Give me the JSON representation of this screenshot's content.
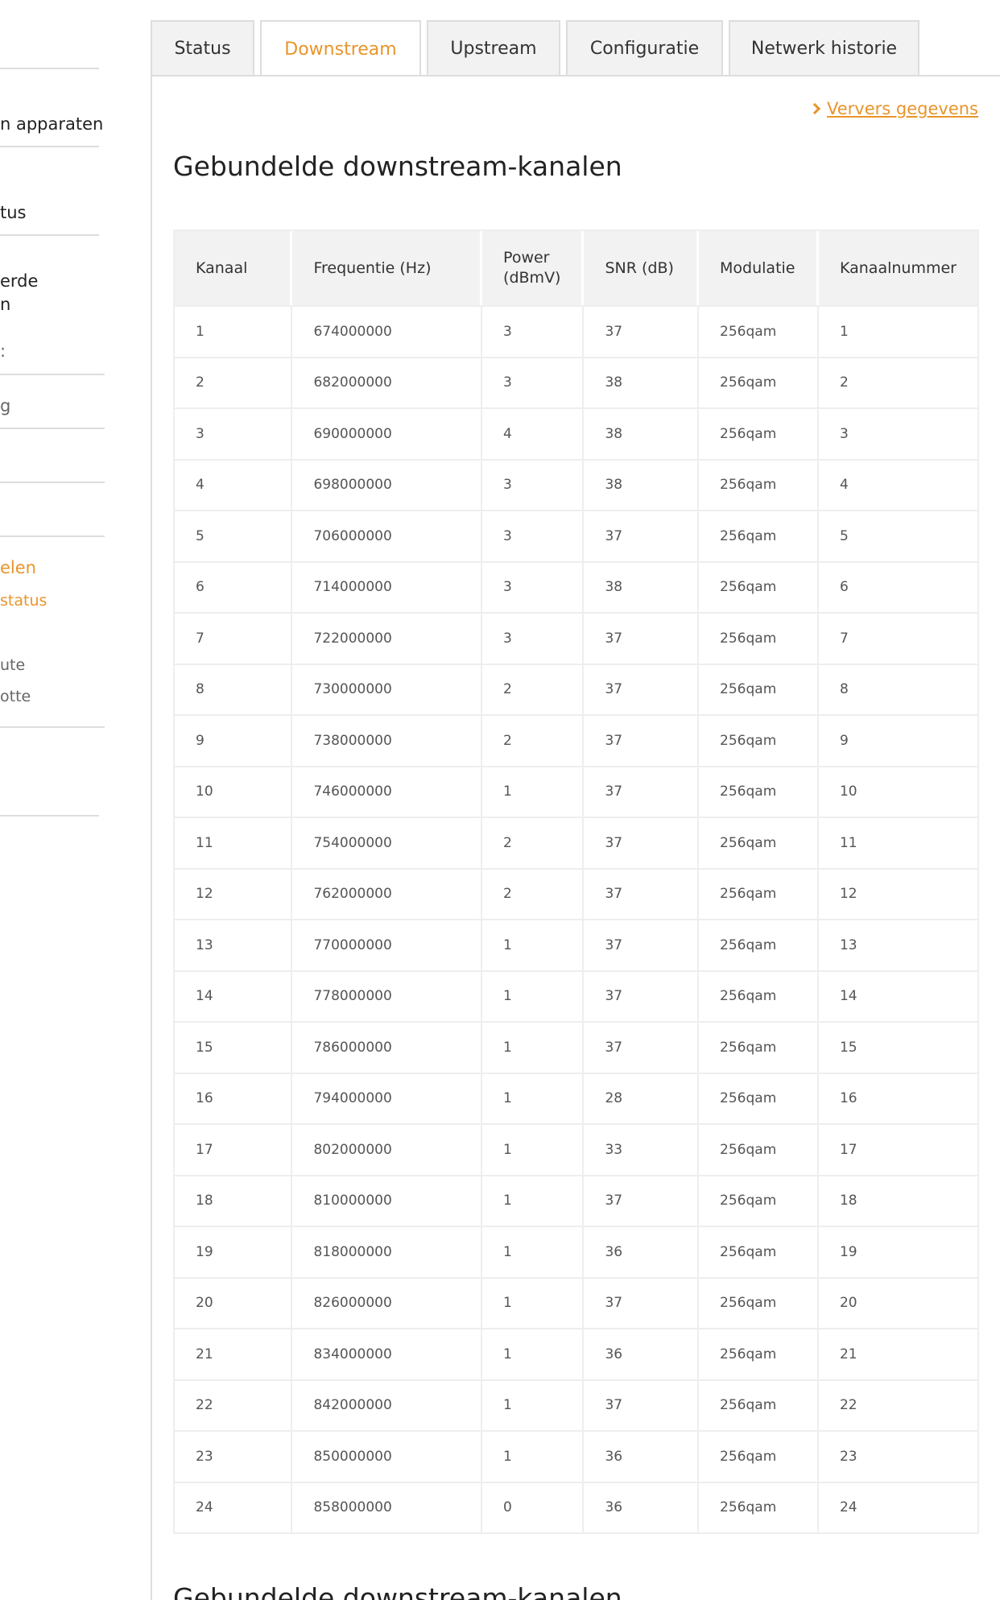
{
  "sidebar": {
    "items": [
      {
        "label": "n apparaten"
      },
      {
        "label": "tus"
      },
      {
        "label": "erde"
      },
      {
        "label": "n"
      },
      {
        "label": ":"
      },
      {
        "label": "g"
      },
      {
        "label": "elen"
      },
      {
        "label": "status"
      },
      {
        "label": "ute"
      },
      {
        "label": "otte"
      }
    ]
  },
  "tabs": [
    {
      "label": "Status"
    },
    {
      "label": "Downstream"
    },
    {
      "label": "Upstream"
    },
    {
      "label": "Configuratie"
    },
    {
      "label": "Netwerk historie"
    }
  ],
  "active_tab": "Downstream",
  "refresh": {
    "label": "Ververs gegevens"
  },
  "section": {
    "title": "Gebundelde downstream-kanalen"
  },
  "section2": {
    "title": "Gebundelde downstream-kanalen"
  },
  "table": {
    "headers": [
      "Kanaal",
      "Frequentie (Hz)",
      "Power (dBmV)",
      "SNR (dB)",
      "Modulatie",
      "Kanaalnummer"
    ],
    "rows": [
      [
        "1",
        "674000000",
        "3",
        "37",
        "256qam",
        "1"
      ],
      [
        "2",
        "682000000",
        "3",
        "38",
        "256qam",
        "2"
      ],
      [
        "3",
        "690000000",
        "4",
        "38",
        "256qam",
        "3"
      ],
      [
        "4",
        "698000000",
        "3",
        "38",
        "256qam",
        "4"
      ],
      [
        "5",
        "706000000",
        "3",
        "37",
        "256qam",
        "5"
      ],
      [
        "6",
        "714000000",
        "3",
        "38",
        "256qam",
        "6"
      ],
      [
        "7",
        "722000000",
        "3",
        "37",
        "256qam",
        "7"
      ],
      [
        "8",
        "730000000",
        "2",
        "37",
        "256qam",
        "8"
      ],
      [
        "9",
        "738000000",
        "2",
        "37",
        "256qam",
        "9"
      ],
      [
        "10",
        "746000000",
        "1",
        "37",
        "256qam",
        "10"
      ],
      [
        "11",
        "754000000",
        "2",
        "37",
        "256qam",
        "11"
      ],
      [
        "12",
        "762000000",
        "2",
        "37",
        "256qam",
        "12"
      ],
      [
        "13",
        "770000000",
        "1",
        "37",
        "256qam",
        "13"
      ],
      [
        "14",
        "778000000",
        "1",
        "37",
        "256qam",
        "14"
      ],
      [
        "15",
        "786000000",
        "1",
        "37",
        "256qam",
        "15"
      ],
      [
        "16",
        "794000000",
        "1",
        "28",
        "256qam",
        "16"
      ],
      [
        "17",
        "802000000",
        "1",
        "33",
        "256qam",
        "17"
      ],
      [
        "18",
        "810000000",
        "1",
        "37",
        "256qam",
        "18"
      ],
      [
        "19",
        "818000000",
        "1",
        "36",
        "256qam",
        "19"
      ],
      [
        "20",
        "826000000",
        "1",
        "37",
        "256qam",
        "20"
      ],
      [
        "21",
        "834000000",
        "1",
        "36",
        "256qam",
        "21"
      ],
      [
        "22",
        "842000000",
        "1",
        "37",
        "256qam",
        "22"
      ],
      [
        "23",
        "850000000",
        "1",
        "36",
        "256qam",
        "23"
      ],
      [
        "24",
        "858000000",
        "0",
        "36",
        "256qam",
        "24"
      ]
    ]
  },
  "colors": {
    "accent": "#e8952b",
    "border": "#dddddd",
    "header_bg": "#f2f2f2"
  }
}
